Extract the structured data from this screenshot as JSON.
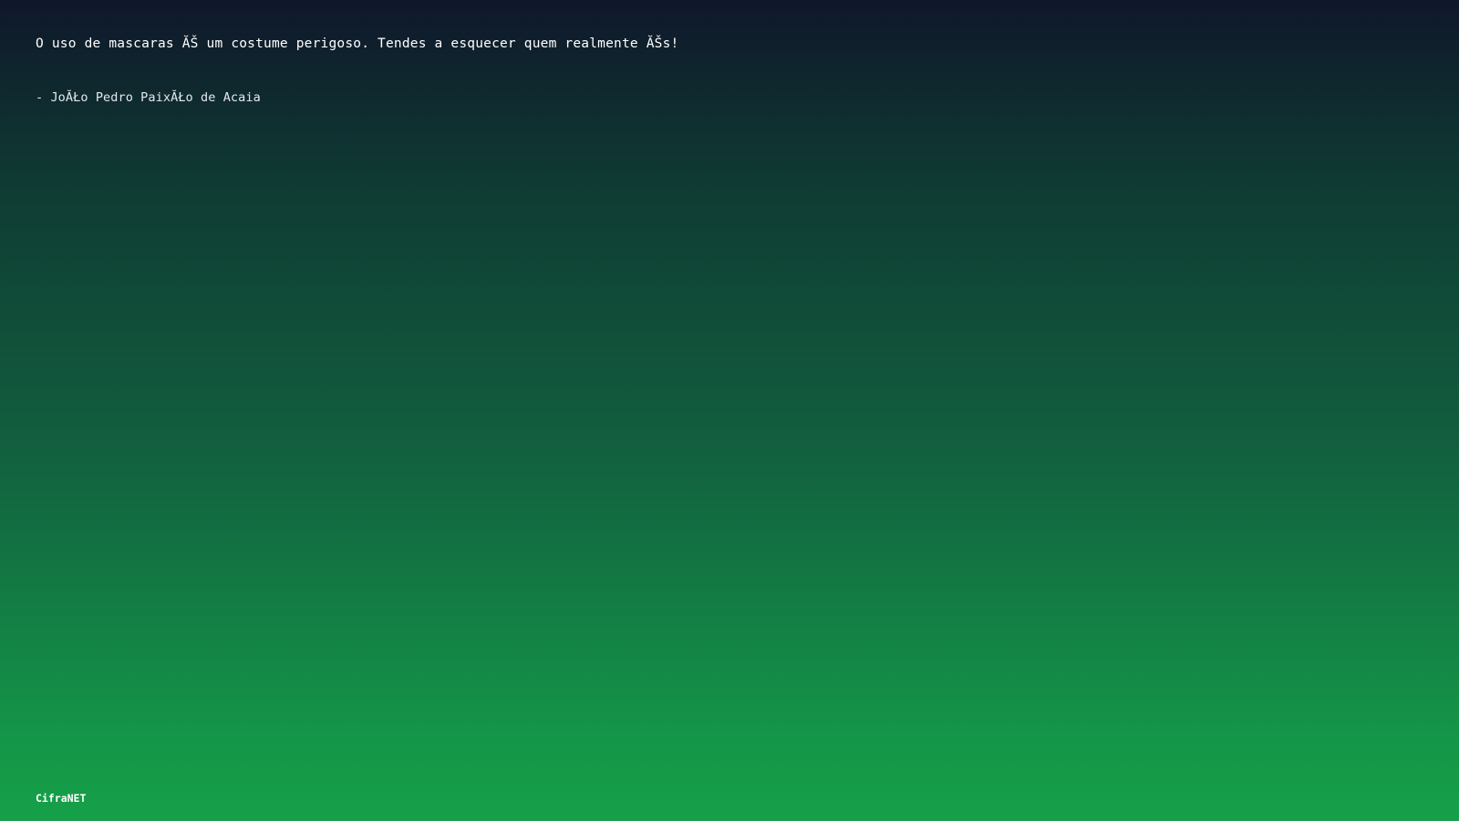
{
  "quote": {
    "text": "O uso de mascaras ĂŠ um costume perigoso. Tendes a esquecer quem realmente ĂŠs!"
  },
  "author": {
    "text": "- JoĂŁo Pedro PaixĂŁo de Acaia"
  },
  "footer": {
    "brand": "CifraNET"
  },
  "colors": {
    "background_top": "#0f172a",
    "background_bottom": "#16a049",
    "text": "#ffffff"
  }
}
